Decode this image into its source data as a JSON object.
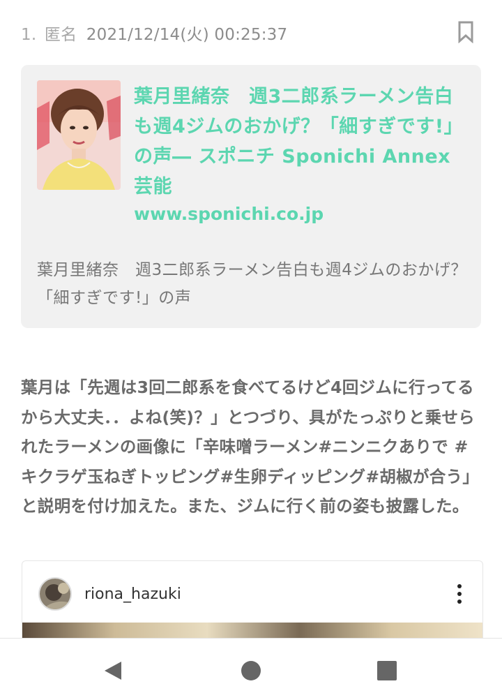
{
  "post": {
    "number": "1.",
    "author": "匿名",
    "datetime": "2021/12/14(火) 00:25:37"
  },
  "link_card": {
    "title": "葉月里緒奈　週3二郎系ラーメン告白も週4ジムのおかげ？「細すぎです!」の声― スポニチ Sponichi Annex 芸能",
    "url": "www.sponichi.co.jp",
    "description": "葉月里緒奈　週3二郎系ラーメン告白も週4ジムのおかげ？「細すぎです!」の声",
    "accent_color": "#5cd6b0"
  },
  "body": {
    "text": "葉月は「先週は3回二郎系を食べてるけど4回ジムに行ってるから大丈夫．．よね(笑)？」とつづり、具がたっぷりと乗せられたラーメンの画像に「辛味噌ラーメン#ニンニクありで #キクラゲ玉ねぎトッピング#生卵ディッピング#胡椒が合う」と説明を付け加えた。また、ジムに行く前の姿も披露した。"
  },
  "embed": {
    "username": "riona_hazuki"
  },
  "icons": {
    "bookmark": "bookmark-icon",
    "more": "more-vertical-icon",
    "back": "back-triangle-icon",
    "home": "home-circle-icon",
    "recent": "recent-square-icon"
  }
}
